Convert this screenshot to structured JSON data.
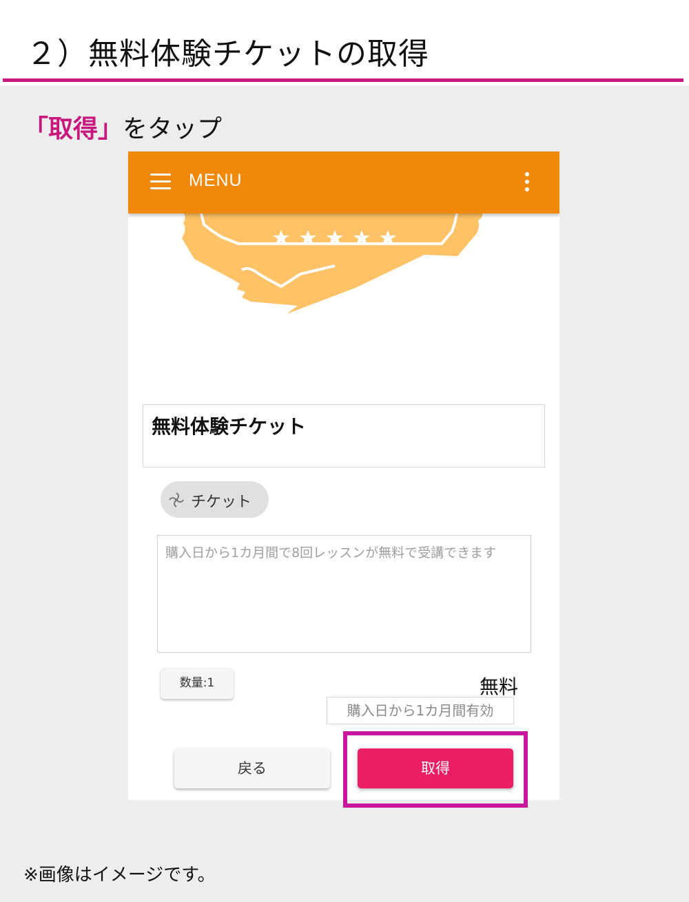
{
  "page": {
    "title": "２）無料体験チケットの取得",
    "instruction_emphasis": "「取得」",
    "instruction_rest": "をタップ",
    "note": "※画像はイメージです。"
  },
  "appbar": {
    "title": "MENU",
    "menu_icon": "hamburger-icon",
    "more_icon": "more-vert-icon"
  },
  "ticket": {
    "name": "無料体験チケット",
    "category_chip": "チケット",
    "category_icon": "ticket-category-icon",
    "description": "購入日から1カ月間で8回レッスンが無料で受講できます",
    "quantity_label": "数量:1",
    "price": "無料",
    "validity": "購入日から1カ月間有効"
  },
  "actions": {
    "back_label": "戻る",
    "get_label": "取得"
  },
  "colors": {
    "accent_magenta": "#c8177d",
    "appbar_orange": "#f0880a",
    "ticket_art": "#ffc266",
    "get_button": "#e91e63"
  }
}
